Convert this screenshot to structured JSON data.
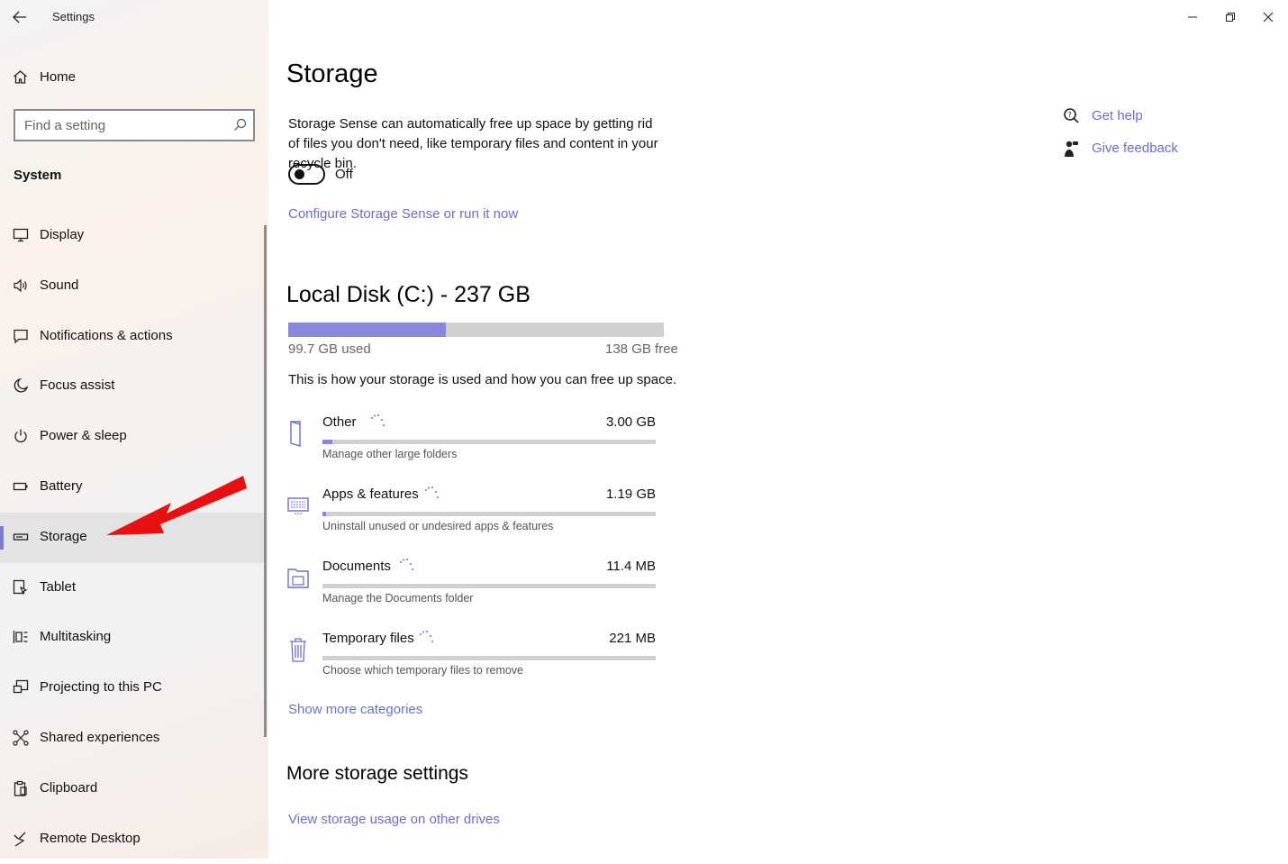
{
  "app": {
    "title": "Settings",
    "home_label": "Home",
    "search_placeholder": "Find a setting",
    "section_title": "System"
  },
  "sidebar": {
    "items": [
      {
        "label": "Display",
        "icon": "monitor-icon"
      },
      {
        "label": "Sound",
        "icon": "speaker-icon"
      },
      {
        "label": "Notifications & actions",
        "icon": "message-icon"
      },
      {
        "label": "Focus assist",
        "icon": "moon-icon"
      },
      {
        "label": "Power & sleep",
        "icon": "power-icon"
      },
      {
        "label": "Battery",
        "icon": "battery-icon"
      },
      {
        "label": "Storage",
        "icon": "drive-icon",
        "selected": true
      },
      {
        "label": "Tablet",
        "icon": "tablet-icon"
      },
      {
        "label": "Multitasking",
        "icon": "multitasking-icon"
      },
      {
        "label": "Projecting to this PC",
        "icon": "projector-icon"
      },
      {
        "label": "Shared experiences",
        "icon": "share-icon"
      },
      {
        "label": "Clipboard",
        "icon": "clipboard-icon"
      },
      {
        "label": "Remote Desktop",
        "icon": "remote-desktop-icon"
      }
    ]
  },
  "main": {
    "title": "Storage",
    "storage_sense_desc": "Storage Sense can automatically free up space by getting rid of files you don't need, like temporary files and content in your recycle bin.",
    "toggle_state": "Off",
    "configure_link": "Configure Storage Sense or run it now",
    "disk": {
      "title": "Local Disk (C:) - 237 GB",
      "used_label": "99.7 GB used",
      "free_label": "138 GB free",
      "used_fraction": 0.42
    },
    "usage_info": "This is how your storage is used and how you can free up space.",
    "categories": [
      {
        "name": "Other",
        "size": "3.00 GB",
        "description": "Manage other large folders",
        "icon": "folder-other-icon",
        "fill": 0.03
      },
      {
        "name": "Apps & features",
        "size": "1.19 GB",
        "description": "Uninstall unused or undesired apps & features",
        "icon": "apps-icon",
        "fill": 0.012
      },
      {
        "name": "Documents",
        "size": "11.4 MB",
        "description": "Manage the Documents folder",
        "icon": "documents-icon",
        "fill": 0.0
      },
      {
        "name": "Temporary files",
        "size": "221 MB",
        "description": "Choose which temporary files to remove",
        "icon": "trash-icon",
        "fill": 0.0
      }
    ],
    "show_more_link": "Show more categories",
    "more_settings_title": "More storage settings",
    "other_drives_link": "View storage usage on other drives"
  },
  "help": {
    "get_help": "Get help",
    "give_feedback": "Give feedback"
  },
  "colors": {
    "accent": "#6c6cd4",
    "bar_fill": "#8a88dc",
    "arrow": "#e81010"
  }
}
